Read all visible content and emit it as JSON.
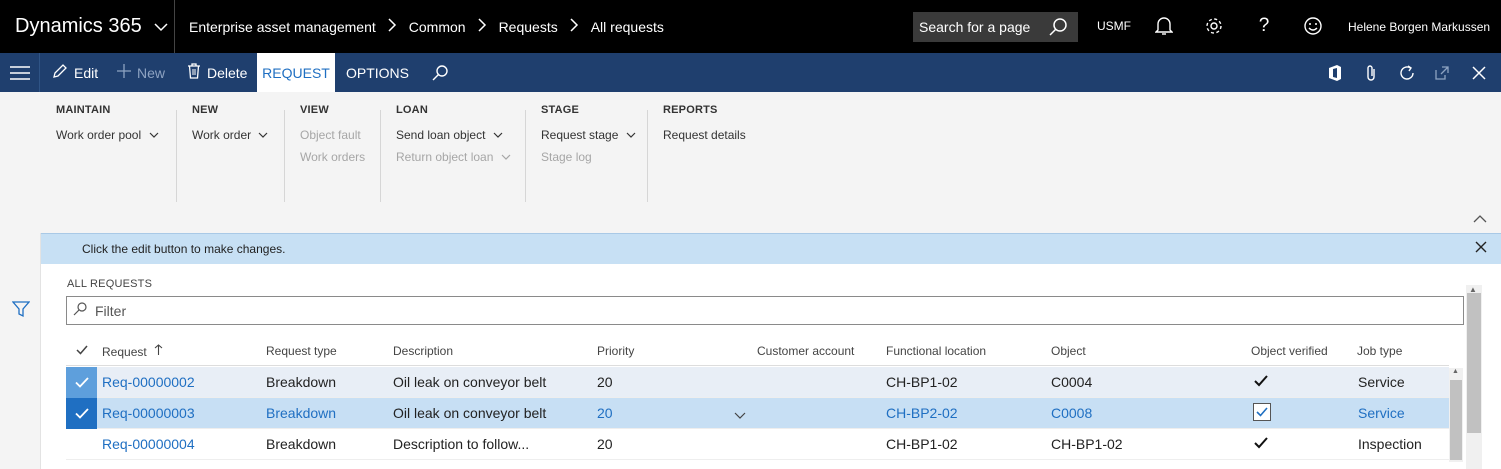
{
  "topbar": {
    "app_name": "Dynamics 365",
    "breadcrumb": [
      "Enterprise asset management",
      "Common",
      "Requests",
      "All requests"
    ],
    "search_placeholder": "Search for a page",
    "company": "USMF",
    "user": "Helene Borgen Markussen",
    "icons": [
      "bell-icon",
      "gear-icon",
      "help-icon",
      "smiley-icon"
    ]
  },
  "actionbar": {
    "edit": "Edit",
    "new": "New",
    "delete": "Delete",
    "tab_request": "REQUEST",
    "tab_options": "OPTIONS"
  },
  "ribbon": {
    "maintain": {
      "title": "MAINTAIN",
      "items": [
        "Work order pool"
      ]
    },
    "new": {
      "title": "NEW",
      "items": [
        "Work order"
      ]
    },
    "view": {
      "title": "VIEW",
      "items": [
        "Object fault",
        "Work orders"
      ]
    },
    "loan": {
      "title": "LOAN",
      "items": [
        "Send loan object",
        "Return object loan"
      ]
    },
    "stage": {
      "title": "STAGE",
      "items": [
        "Request stage",
        "Stage log"
      ]
    },
    "reports": {
      "title": "REPORTS",
      "items": [
        "Request details"
      ]
    }
  },
  "message": "Click the edit button to make changes.",
  "list": {
    "title": "ALL REQUESTS",
    "filter_placeholder": "Filter",
    "columns": [
      "Request",
      "Request type",
      "Description",
      "Priority",
      "Customer account",
      "Functional location",
      "Object",
      "Object verified",
      "Job type"
    ],
    "rows": [
      {
        "request": "Req-00000002",
        "type": "Breakdown",
        "description": "Oil leak on conveyor belt",
        "priority": "20",
        "customer": "",
        "location": "CH-BP1-02",
        "object": "C0004",
        "verified": true,
        "job": "Service"
      },
      {
        "request": "Req-00000003",
        "type": "Breakdown",
        "description": "Oil leak on conveyor belt",
        "priority": "20",
        "customer": "",
        "location": "CH-BP2-02",
        "object": "C0008",
        "verified": true,
        "job": "Service"
      },
      {
        "request": "Req-00000004",
        "type": "Breakdown",
        "description": "Description to follow...",
        "priority": "20",
        "customer": "",
        "location": "CH-BP1-02",
        "object": "CH-BP1-02",
        "verified": true,
        "job": "Inspection"
      }
    ]
  },
  "colors": {
    "topbar": "#000000",
    "actionbar": "#1f3f6e",
    "accent": "#1f6fc2",
    "message": "#c7e0f4"
  }
}
